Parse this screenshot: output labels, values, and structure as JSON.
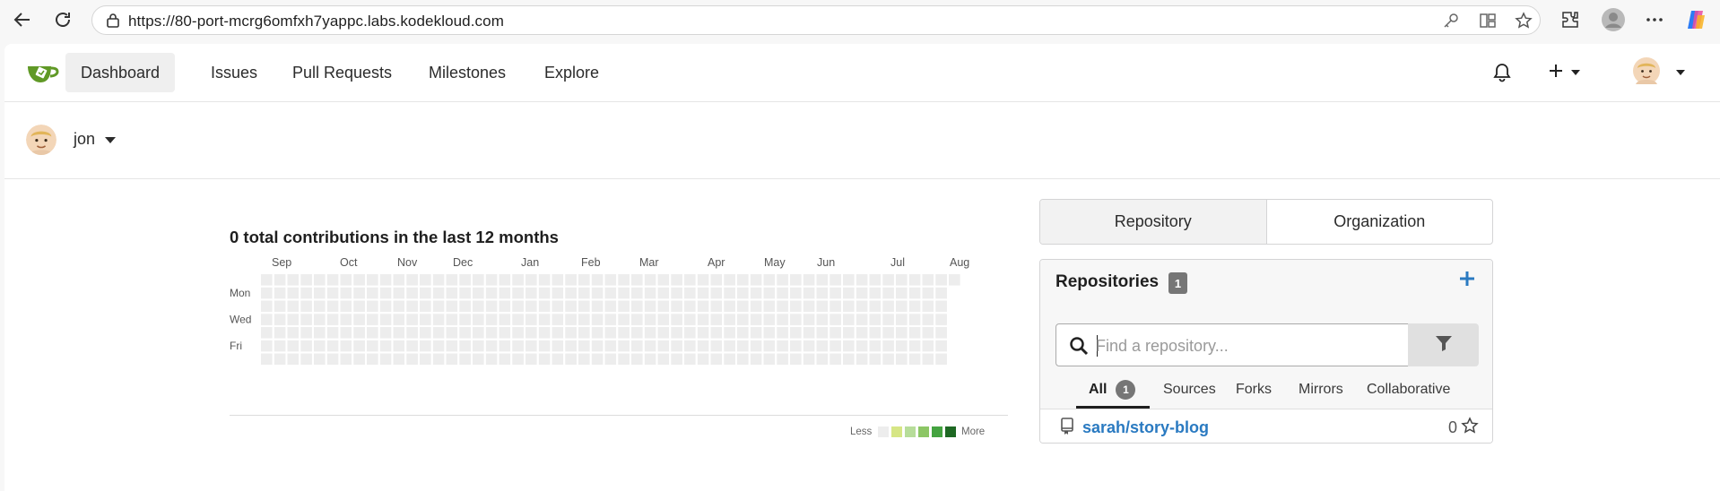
{
  "browser": {
    "url": "https://80-port-mcrg6omfxh7yappc.labs.kodekloud.com",
    "icons": [
      "back-icon",
      "refresh-icon",
      "site-info-icon",
      "key-icon",
      "split-screen-icon",
      "favorite-star-icon",
      "extensions-icon",
      "profile-icon",
      "more-icon",
      "copilot-icon"
    ]
  },
  "nav": {
    "items": [
      {
        "label": "Dashboard",
        "active": true
      },
      {
        "label": "Issues",
        "active": false
      },
      {
        "label": "Pull Requests",
        "active": false
      },
      {
        "label": "Milestones",
        "active": false
      },
      {
        "label": "Explore",
        "active": false
      }
    ],
    "right_icons": [
      "bell-icon",
      "plus-icon",
      "user-avatar-icon"
    ]
  },
  "user": {
    "name": "jon"
  },
  "heatmap": {
    "title": "0 total contributions in the last 12 months",
    "months": [
      "Sep",
      "Oct",
      "Nov",
      "Dec",
      "Jan",
      "Feb",
      "Mar",
      "Apr",
      "May",
      "Jun",
      "Jul",
      "Aug"
    ],
    "days": [
      "Mon",
      "Wed",
      "Fri"
    ],
    "less_label": "Less",
    "more_label": "More",
    "total": 0,
    "empty_color": "#ededed",
    "scale_colors": [
      "#ededed",
      "#d6e685",
      "#b7dd9a",
      "#8cc665",
      "#44a340",
      "#1e6823"
    ]
  },
  "panel": {
    "tabs": [
      {
        "label": "Repository",
        "active": true
      },
      {
        "label": "Organization",
        "active": false
      }
    ],
    "repos_title": "Repositories",
    "repos_count": "1",
    "search_placeholder": "Find a repository...",
    "filters": [
      {
        "label": "All",
        "badge": "1",
        "active": true
      },
      {
        "label": "Sources"
      },
      {
        "label": "Forks"
      },
      {
        "label": "Mirrors"
      },
      {
        "label": "Collaborative"
      }
    ],
    "repos": [
      {
        "name": "sarah/story-blog",
        "stars": "0"
      }
    ]
  },
  "colors": {
    "link": "#2a7ac1",
    "accent_green": "#609926",
    "badge_grey": "#767676"
  }
}
